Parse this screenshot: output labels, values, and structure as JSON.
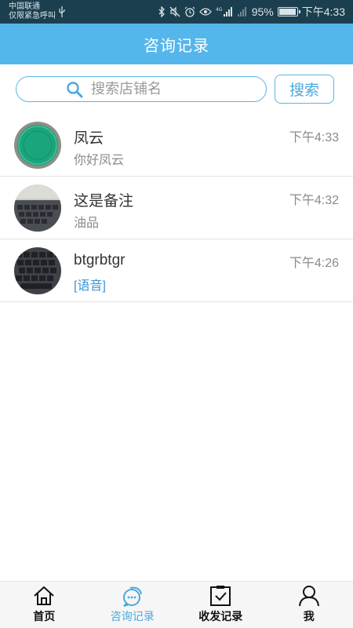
{
  "status_bar": {
    "carrier_line1": "中国联通",
    "carrier_line2": "仅限紧急呼叫",
    "battery": "95%",
    "battery_level": 0.95,
    "time": "下午4:33",
    "icons": [
      "usb-icon",
      "bluetooth-icon",
      "mute-icon",
      "alarm-icon",
      "eye-icon",
      "signal-4g-icon",
      "signal-icon",
      "battery-icon"
    ]
  },
  "header": {
    "title": "咨询记录"
  },
  "search": {
    "placeholder": "搜索店铺名",
    "value": "",
    "button_label": "搜索"
  },
  "conversations": [
    {
      "name": "凤云",
      "preview": "你好凤云",
      "time": "下午4:33",
      "avatar": "green-disc-photo"
    },
    {
      "name": "这是备注",
      "preview": "油品",
      "time": "下午4:32",
      "avatar": "keyboard-photo"
    },
    {
      "name": "btgrbtgr",
      "preview": "[语音]",
      "time": "下午4:26",
      "avatar": "keyboard-photo-dark"
    }
  ],
  "nav": {
    "items": [
      {
        "label": "首页",
        "icon": "home-icon",
        "active": false
      },
      {
        "label": "咨询记录",
        "icon": "chat-icon",
        "active": true
      },
      {
        "label": "收发记录",
        "icon": "clipboard-check-icon",
        "active": false
      },
      {
        "label": "我",
        "icon": "person-icon",
        "active": false
      }
    ]
  },
  "colors": {
    "accent": "#55b6ec",
    "status_bar": "#1b3f4e",
    "voice_text": "#3a96d8"
  }
}
